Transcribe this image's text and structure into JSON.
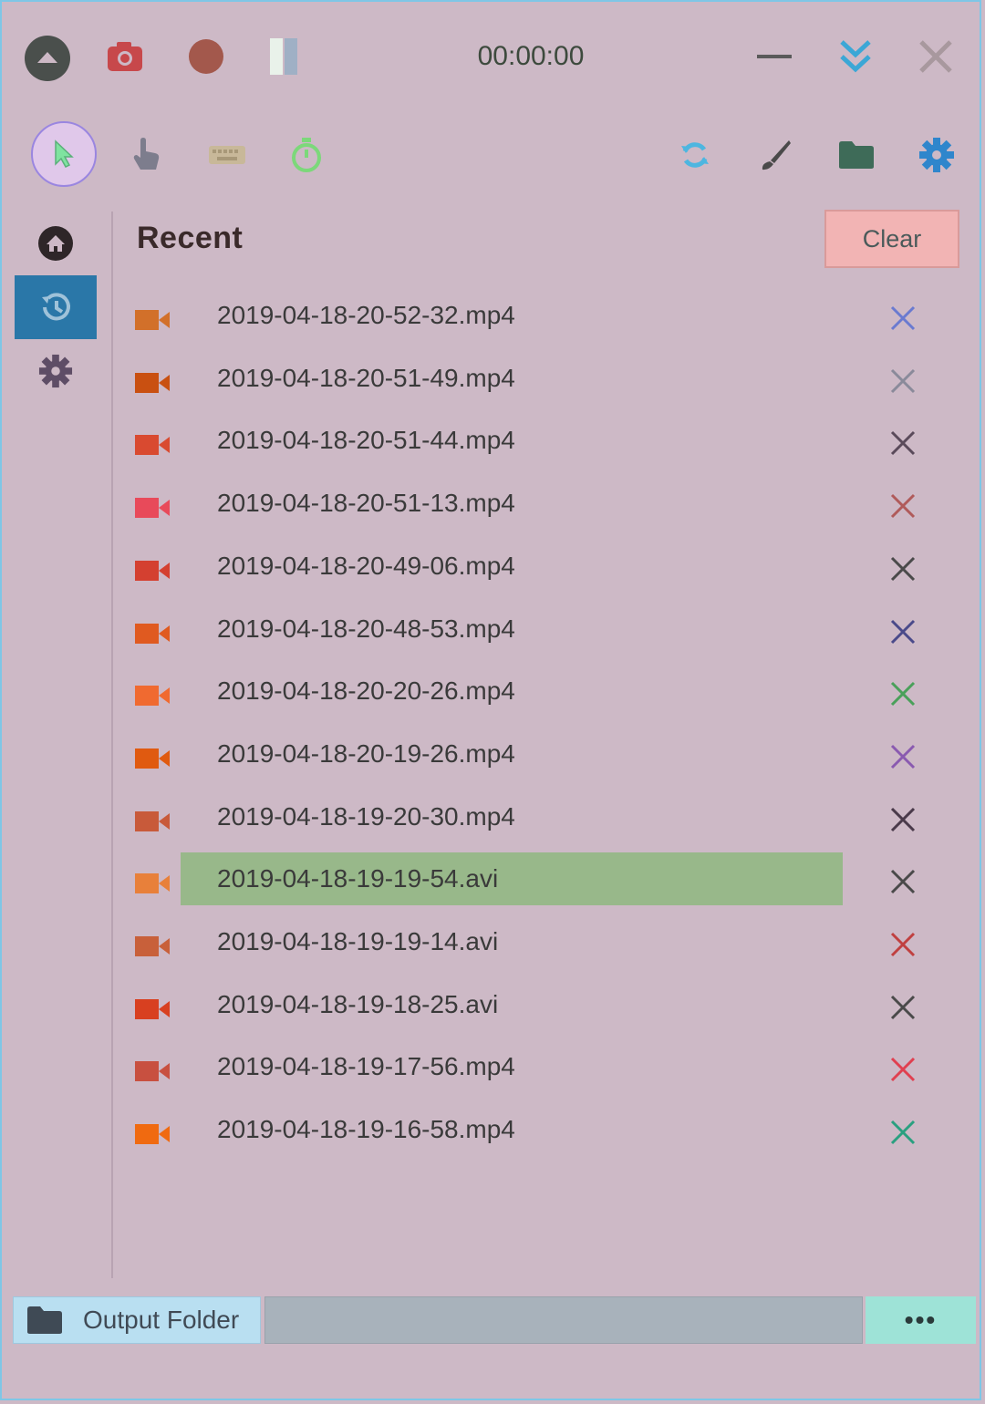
{
  "titlebar": {
    "timer": "00:00:00",
    "icons": [
      "collapse-up-icon",
      "camera-icon",
      "record-icon",
      "pause-icon",
      "minimize-icon",
      "chevron-double-down-icon",
      "close-icon"
    ]
  },
  "toolbar": {
    "left_tools": [
      "cursor-icon",
      "hand-pointer-icon",
      "keyboard-icon",
      "stopwatch-icon"
    ],
    "right_tools": [
      "refresh-icon",
      "brush-icon",
      "folder-icon",
      "gear-icon"
    ]
  },
  "sidebar": {
    "items": [
      {
        "icon": "home-icon"
      },
      {
        "icon": "history-icon",
        "active": true
      },
      {
        "icon": "settings-gear-icon"
      }
    ]
  },
  "recent": {
    "title": "Recent",
    "clear_label": "Clear",
    "files": [
      {
        "name": "2019-04-18-20-52-32.mp4",
        "icon_color": "#d2702a",
        "x_color": "#6a7ad0"
      },
      {
        "name": "2019-04-18-20-51-49.mp4",
        "icon_color": "#c95011",
        "x_color": "#8a8a9a"
      },
      {
        "name": "2019-04-18-20-51-44.mp4",
        "icon_color": "#d94a30",
        "x_color": "#5a4a5a"
      },
      {
        "name": "2019-04-18-20-51-13.mp4",
        "icon_color": "#e84a5a",
        "x_color": "#b05a5a"
      },
      {
        "name": "2019-04-18-20-49-06.mp4",
        "icon_color": "#d44030",
        "x_color": "#4a4a4a"
      },
      {
        "name": "2019-04-18-20-48-53.mp4",
        "icon_color": "#e05a20",
        "x_color": "#4a4a8a"
      },
      {
        "name": "2019-04-18-20-20-26.mp4",
        "icon_color": "#f06a30",
        "x_color": "#4aa05a"
      },
      {
        "name": "2019-04-18-20-19-26.mp4",
        "icon_color": "#e05a10",
        "x_color": "#8a5ab0"
      },
      {
        "name": "2019-04-18-19-20-30.mp4",
        "icon_color": "#c85a3a",
        "x_color": "#4a3a4a"
      },
      {
        "name": "2019-04-18-19-19-54.avi",
        "icon_color": "#e8803a",
        "x_color": "#4a4a4a",
        "selected": true
      },
      {
        "name": "2019-04-18-19-19-14.avi",
        "icon_color": "#c8603a",
        "x_color": "#c04040"
      },
      {
        "name": "2019-04-18-19-18-25.avi",
        "icon_color": "#d84020",
        "x_color": "#4a4a4a"
      },
      {
        "name": "2019-04-18-19-17-56.mp4",
        "icon_color": "#c85040",
        "x_color": "#e04050"
      },
      {
        "name": "2019-04-18-19-16-58.mp4",
        "icon_color": "#f06a10",
        "x_color": "#2aa080"
      }
    ]
  },
  "bottombar": {
    "output_folder_label": "Output Folder",
    "path_value": "",
    "more_label": "•••"
  }
}
